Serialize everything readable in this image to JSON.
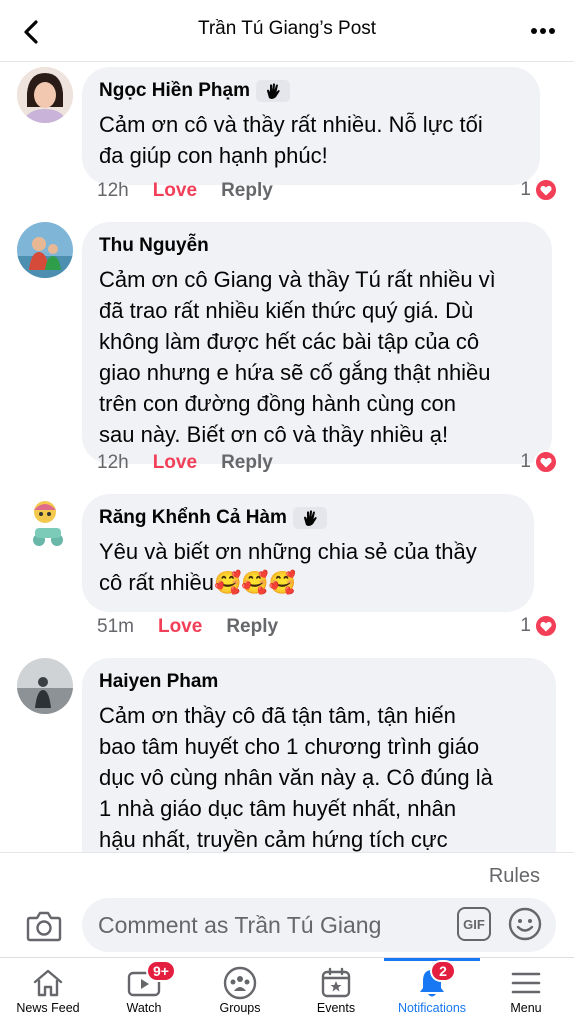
{
  "header": {
    "title": "Trần Tú Giang’s Post"
  },
  "comments": [
    {
      "author": "Ngọc Hiền Phạm",
      "has_badge": true,
      "text": "Cảm ơn cô và thầy rất nhiều. Nỗ lực tối\nđa giúp con hạnh phúc!",
      "time": "12h",
      "love": "Love",
      "reply": "Reply",
      "reactions": "1"
    },
    {
      "author": "Thu Nguyễn",
      "has_badge": false,
      "text": "Cảm ơn cô Giang và thầy Tú rất nhiều vì\nđã trao rất nhiều kiến thức quý giá. Dù\nkhông làm được hết các bài tập của cô\ngiao nhưng e hứa sẽ cố gắng thật nhiều\ntrên con đường đồng hành cùng con\nsau này.  Biết ơn cô và thầy nhiều ạ!",
      "time": "12h",
      "love": "Love",
      "reply": "Reply",
      "reactions": "1"
    },
    {
      "author": "Răng Khểnh Cả Hàm",
      "has_badge": true,
      "text": "Yêu và biết ơn những chia sẻ của thầy\ncô rất nhiều🥰🥰🥰",
      "time": "51m",
      "love": "Love",
      "reply": "Reply",
      "reactions": "1"
    },
    {
      "author": "Haiyen Pham",
      "has_badge": false,
      "text": "Cảm ơn thầy cô đã tận tâm, tận hiến\nbao tâm huyết cho 1 chương trình giáo\ndục vô cùng nhân văn này ạ. Cô đúng là\n1 nhà giáo dục tâm huyết nhất, nhân\nhậu nhất, truyền cảm hứng tích cực\nnhiều nhất mà e từng gặp trong cuộc"
    }
  ],
  "rules_label": "Rules",
  "composer": {
    "placeholder": "Comment as Trần Tú Giang",
    "gif_label": "GIF"
  },
  "tabs": [
    {
      "label": "News Feed",
      "icon": "home-icon"
    },
    {
      "label": "Watch",
      "icon": "video-icon",
      "badge": "9+"
    },
    {
      "label": "Groups",
      "icon": "groups-icon"
    },
    {
      "label": "Events",
      "icon": "calendar-star-icon"
    },
    {
      "label": "Notifications",
      "icon": "bell-icon",
      "badge": "2",
      "active": true
    },
    {
      "label": "Menu",
      "icon": "hamburger-icon"
    }
  ],
  "colors": {
    "accent": "#1877f2",
    "love": "#f33e58",
    "badge": "#e41e3f",
    "bubble": "#f0f2f5",
    "secondary_text": "#65676b"
  }
}
